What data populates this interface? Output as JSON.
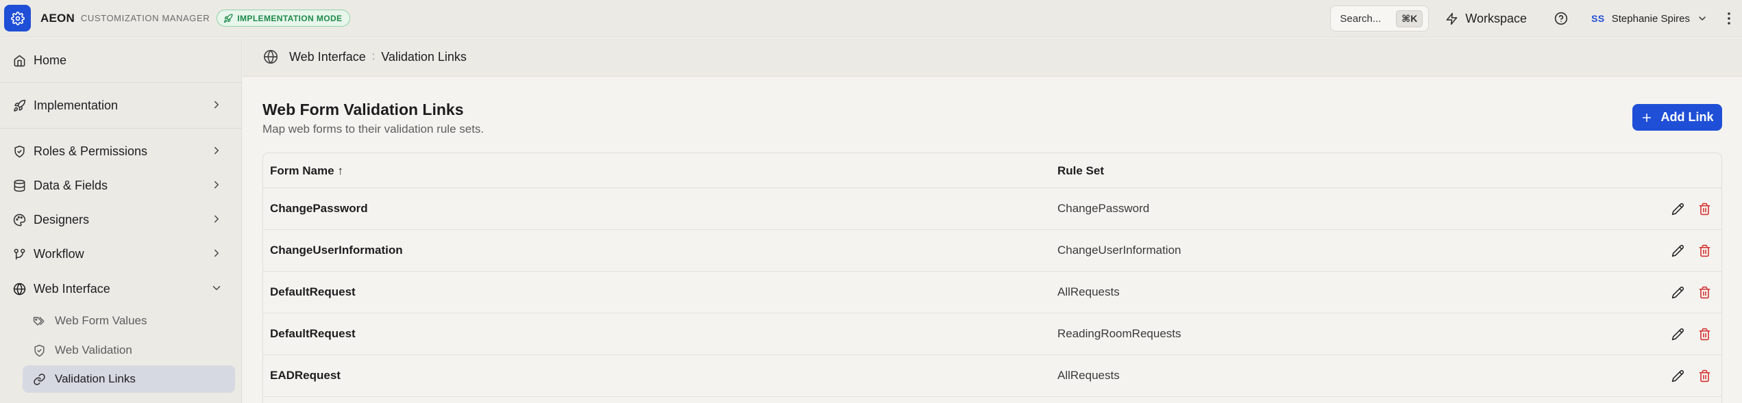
{
  "header": {
    "brand": "AEON",
    "brand_sub": "CUSTOMIZATION MANAGER",
    "mode_badge": "IMPLEMENTATION MODE",
    "search_label": "Search...",
    "search_shortcut": "⌘K",
    "workspace_label": "Workspace",
    "user_initials": "SS",
    "user_name": "Stephanie Spires"
  },
  "sidebar": {
    "items": [
      {
        "label": "Home",
        "icon": "home-icon"
      },
      {
        "label": "Implementation",
        "icon": "rocket-icon"
      },
      {
        "label": "Roles & Permissions",
        "icon": "shield-icon"
      },
      {
        "label": "Data & Fields",
        "icon": "database-icon"
      },
      {
        "label": "Designers",
        "icon": "palette-icon"
      },
      {
        "label": "Workflow",
        "icon": "workflow-icon"
      },
      {
        "label": "Web Interface",
        "icon": "globe-icon"
      }
    ],
    "sub_items": [
      {
        "label": "Web Form Values",
        "icon": "tags-icon"
      },
      {
        "label": "Web Validation",
        "icon": "shield-check-icon"
      },
      {
        "label": "Validation Links",
        "icon": "link-icon"
      }
    ]
  },
  "breadcrumb": {
    "section": "Web Interface",
    "separator": ":",
    "page": "Validation Links"
  },
  "main": {
    "title": "Web Form Validation Links",
    "subtitle": "Map web forms to their validation rule sets.",
    "add_label": "Add Link"
  },
  "table": {
    "columns": {
      "form_name": "Form Name",
      "sort_indicator": "↑",
      "rule_set": "Rule Set"
    },
    "rows": [
      {
        "form": "ChangePassword",
        "rule": "ChangePassword"
      },
      {
        "form": "ChangeUserInformation",
        "rule": "ChangeUserInformation"
      },
      {
        "form": "DefaultRequest",
        "rule": "AllRequests"
      },
      {
        "form": "DefaultRequest",
        "rule": "ReadingRoomRequests"
      },
      {
        "form": "EADRequest",
        "rule": "AllRequests"
      }
    ]
  },
  "colors": {
    "accent": "#1f4fd6",
    "mode_green": "#1e8a4a",
    "delete_red": "#d32f2f",
    "active_nav": "#d7d9e2"
  }
}
